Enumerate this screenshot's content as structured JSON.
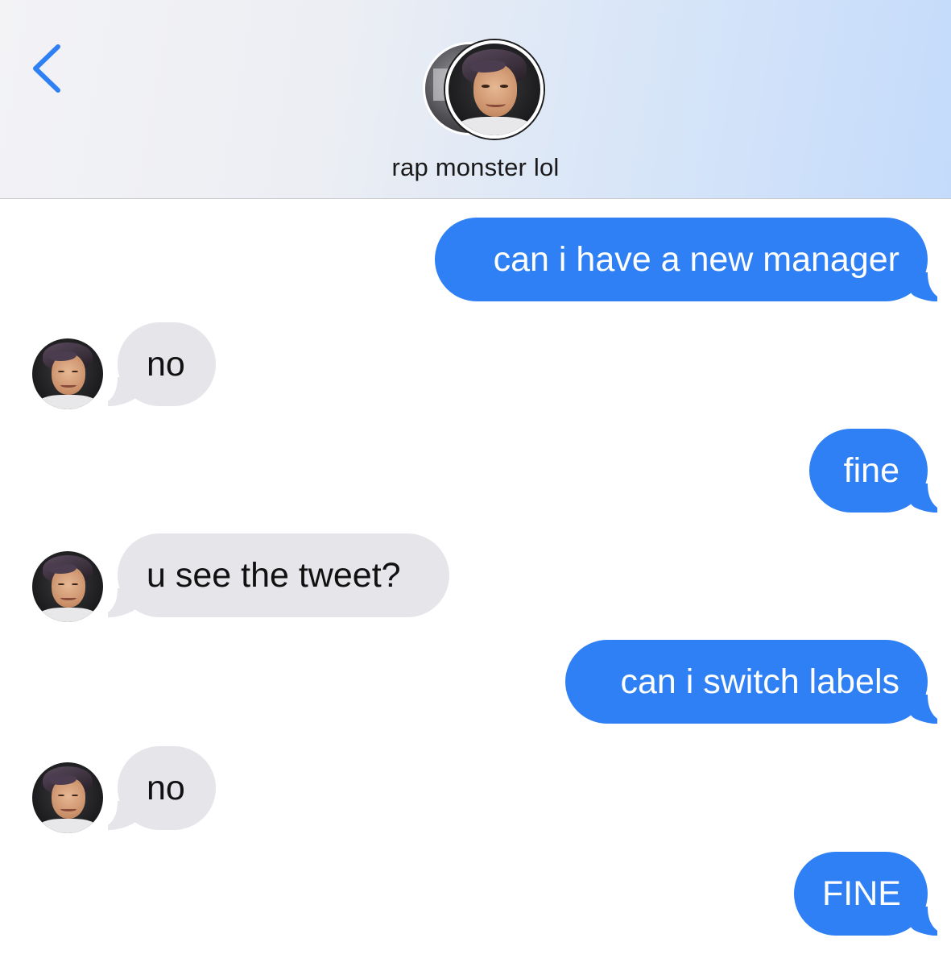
{
  "header": {
    "contact_name": "rap monster lol",
    "back_icon": "chevron-left-icon",
    "accent_color": "#2f7ff5"
  },
  "messages": [
    {
      "direction": "sent",
      "text": "can i have a new manager"
    },
    {
      "direction": "received",
      "text": "no"
    },
    {
      "direction": "sent",
      "text": "fine"
    },
    {
      "direction": "received",
      "text": "u see the tweet?"
    },
    {
      "direction": "sent",
      "text": "can i switch labels"
    },
    {
      "direction": "received",
      "text": "no"
    },
    {
      "direction": "sent",
      "text": "FINE"
    }
  ],
  "colors": {
    "sent_bubble": "#2f7ff5",
    "received_bubble": "#e5e5ea"
  }
}
